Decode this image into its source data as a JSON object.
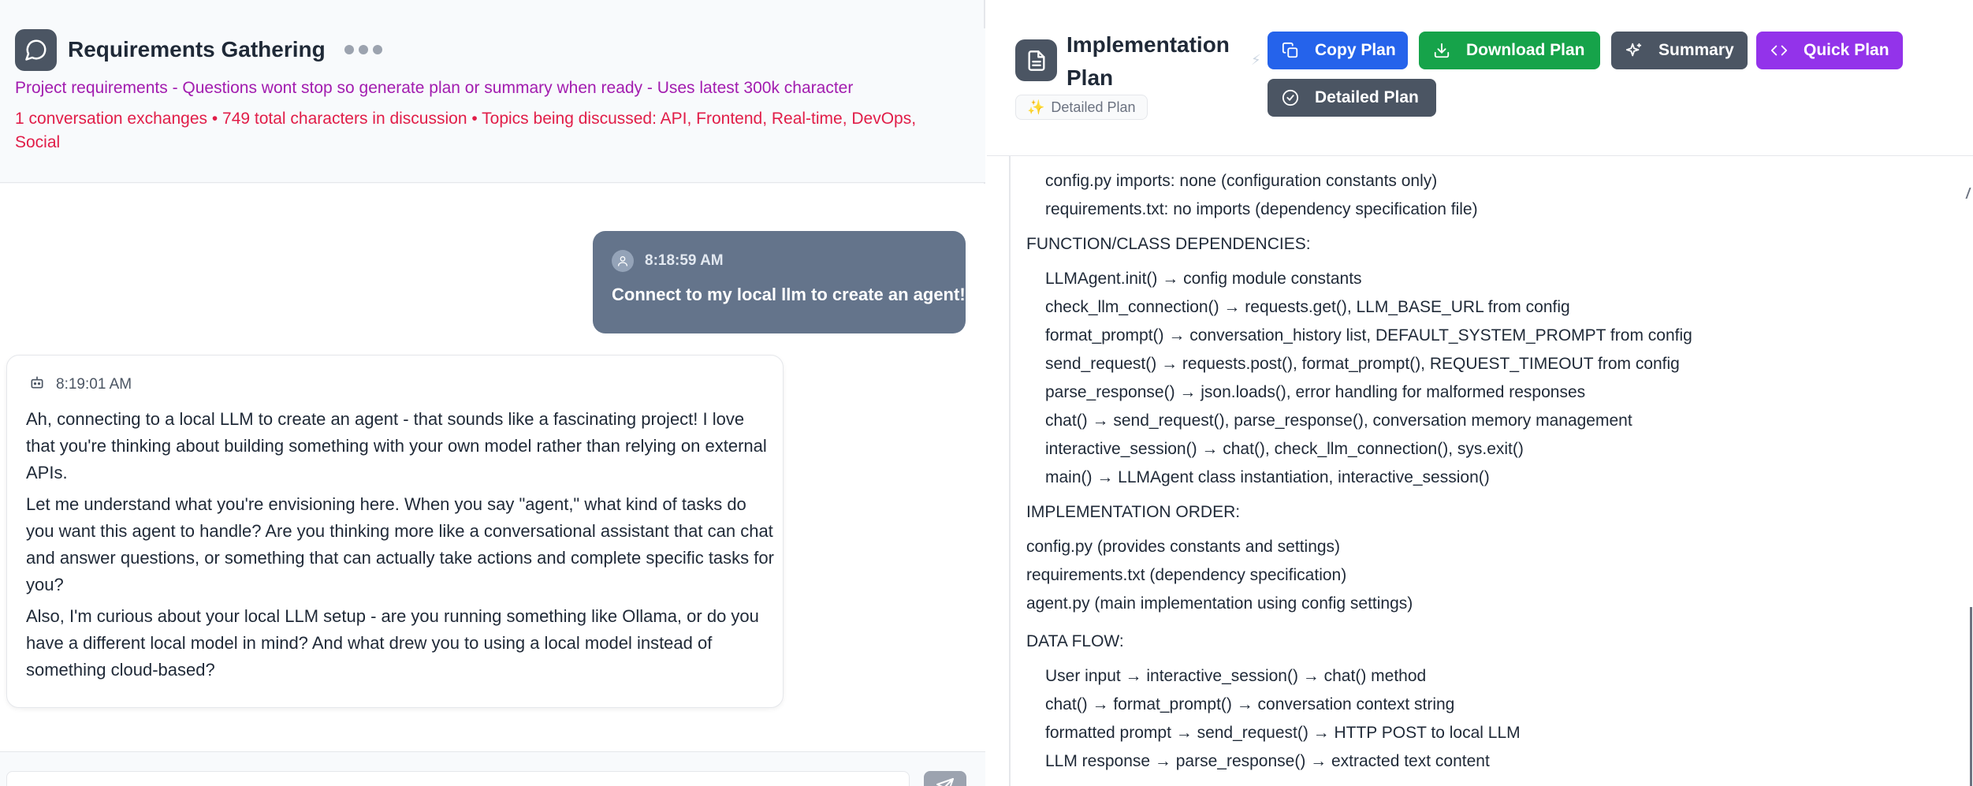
{
  "chat": {
    "title": "Requirements Gathering",
    "subtitle": "Project requirements - Questions wont stop so generate plan or summary when ready - Uses latest 300k character",
    "stats": "1 conversation exchanges • 749 total characters in discussion • Topics being discussed: API, Frontend, Real-time, DevOps, Social",
    "messages": [
      {
        "role": "user",
        "time": "8:18:59 AM",
        "text": "Connect to my local llm to create an agent!"
      },
      {
        "role": "assistant",
        "time": "8:19:01 AM",
        "paragraphs": [
          "Ah, connecting to a local LLM to create an agent - that sounds like a fascinating project! I love that you're thinking about building something with your own model rather than relying on external APIs.",
          "Let me understand what you're envisioning here. When you say \"agent,\" what kind of tasks do you want this agent to handle? Are you thinking more like a conversational assistant that can chat and answer questions, or something that can actually take actions and complete specific tasks for you?",
          "Also, I'm curious about your local LLM setup - are you running something like Ollama, or do you have a different local model in mind? And what drew you to using a local model instead of something cloud-based?"
        ]
      }
    ],
    "input": {
      "value": ""
    }
  },
  "plan": {
    "title": "Implementation Plan",
    "mode_chip": "Detailed Plan",
    "buttons": {
      "copy": "Copy Plan",
      "download": "Download Plan",
      "summary": "Summary",
      "quick": "Quick Plan",
      "detailed": "Detailed Plan"
    },
    "content": {
      "partial_top": "config.py imports: none (configuration constants only)",
      "requirements_line": "requirements.txt: no imports (dependency specification file)",
      "func_heading": "FUNCTION/CLASS DEPENDENCIES:",
      "func_lines": [
        "LLMAgent.init() → config module constants",
        "check_llm_connection() → requests.get(), LLM_BASE_URL from config",
        "format_prompt() → conversation_history list, DEFAULT_SYSTEM_PROMPT from config",
        "send_request() → requests.post(), format_prompt(), REQUEST_TIMEOUT from config",
        "parse_response() → json.loads(), error handling for malformed responses",
        "chat() → send_request(), parse_response(), conversation memory management",
        "interactive_session() → chat(), check_llm_connection(), sys.exit()",
        "main() → LLMAgent class instantiation, interactive_session()"
      ],
      "order_heading": "IMPLEMENTATION ORDER:",
      "order_lines": [
        "config.py (provides constants and settings)",
        "requirements.txt (dependency specification)",
        "agent.py (main implementation using config settings)"
      ],
      "flow_heading": "DATA FLOW:",
      "flow_lines": [
        "User input → interactive_session() → chat() method",
        "chat() → format_prompt() → conversation context string",
        "formatted prompt → send_request() → HTTP POST to local LLM",
        "LLM response → parse_response() → extracted text content"
      ]
    }
  },
  "colors": {
    "copy": "#2563eb",
    "download": "#16a34a",
    "summary": "#4b5563",
    "quick": "#9333ea",
    "subtitle": "#a21caf",
    "stats": "#e11d48",
    "user_bubble": "#64748b"
  },
  "icons": [
    "chat-bubble-icon",
    "more-dots-icon",
    "user-icon",
    "bot-icon",
    "send-icon",
    "document-icon",
    "bolt-icon",
    "sparkle-icon",
    "copy-icon",
    "download-icon",
    "sparkles-icon",
    "code-icon",
    "check-circle-icon"
  ]
}
